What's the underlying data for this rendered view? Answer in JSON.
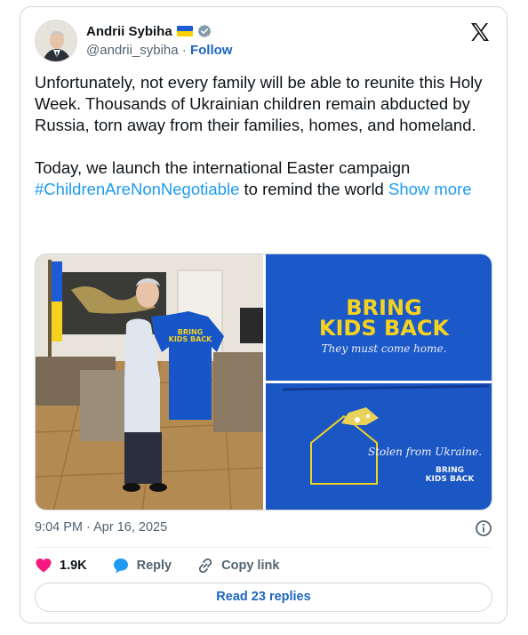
{
  "author": {
    "name": "Andrii Sybiha",
    "handle": "@andrii_sybiha",
    "separator": "·",
    "follow_label": "Follow"
  },
  "tweet": {
    "text_part1": "Unfortunately, not every family will be able to reunite this Holy Week. Thousands of Ukrainian children remain abducted by Russia, torn away from their families, homes, and homeland.\n\nToday, we launch the international Easter campaign ",
    "hashtag": "#ChildrenAreNonNegotiable",
    "text_part2": " to remind the world ",
    "show_more": "Show more"
  },
  "media": {
    "sweatshirt_small_line1": "BRING",
    "sweatshirt_small_line2": "KIDS BACK",
    "slogan_line1": "BRING",
    "slogan_line2": "KIDS BACK",
    "tagline": "They must come home.",
    "stolen_text": "Stolen from Ukraine.",
    "badge_line1": "BRING",
    "badge_line2": "KIDS BACK"
  },
  "meta": {
    "time": "9:04 PM",
    "separator": "·",
    "date": "Apr 16, 2025"
  },
  "actions": {
    "like_count": "1.9K",
    "reply_label": "Reply",
    "copy_label": "Copy link"
  },
  "read_replies_label": "Read 23 replies",
  "colors": {
    "link": "#1d9bf0",
    "follow": "#1d65c1",
    "like": "#f91880",
    "reply": "#1d9bf0",
    "sweatshirt_blue": "#1656c9",
    "slogan_yellow": "#f4d21f"
  }
}
